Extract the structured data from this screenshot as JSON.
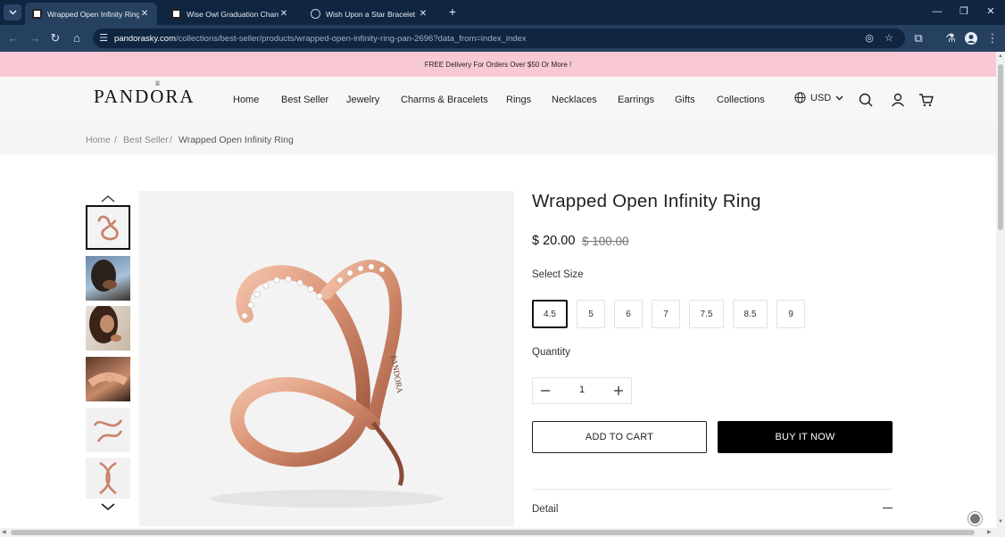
{
  "browser": {
    "tabs": [
      {
        "title": "Wrapped Open Infinity Ring - P",
        "active": true
      },
      {
        "title": "Wise Owl Graduation Charm - P",
        "active": false
      },
      {
        "title": "Wish Upon a Star Bracelet Set",
        "active": false
      }
    ],
    "url_host": "pandorasky.com",
    "url_path": "/collections/best-seller/products/wrapped-open-infinity-ring-pan-2696?data_from=index_index",
    "colors": {
      "tabbar": "#0f2540",
      "toolbar": "#26415f"
    }
  },
  "promo": {
    "text": "FREE Delivery For Orders Over $50 Or More !",
    "bg": "#f8c8d4"
  },
  "header": {
    "logo": "PANDORA",
    "nav": [
      "Home",
      "Best Seller",
      "Jewelry",
      "Charms & Bracelets",
      "Rings",
      "Necklaces",
      "Earrings",
      "Gifts",
      "Collections"
    ],
    "currency": "USD",
    "icons": [
      "globe-icon",
      "search-icon",
      "account-icon",
      "cart-icon"
    ]
  },
  "breadcrumb": {
    "items": [
      "Home",
      "Best Seller"
    ],
    "separator": "/",
    "current": "Wrapped Open Infinity Ring"
  },
  "product": {
    "title": "Wrapped Open Infinity Ring",
    "price": "$ 20.00",
    "compare_price": "$ 100.00",
    "size_label": "Select Size",
    "sizes": [
      "4.5",
      "5",
      "6",
      "7",
      "7.5",
      "8.5",
      "9"
    ],
    "selected_size": "4.5",
    "quantity_label": "Quantity",
    "quantity": "1",
    "add_to_cart": "ADD TO CART",
    "buy_now": "BUY IT NOW",
    "detail_label": "Detail",
    "thumbnail_count": 6,
    "selected_thumbnail": 0
  }
}
